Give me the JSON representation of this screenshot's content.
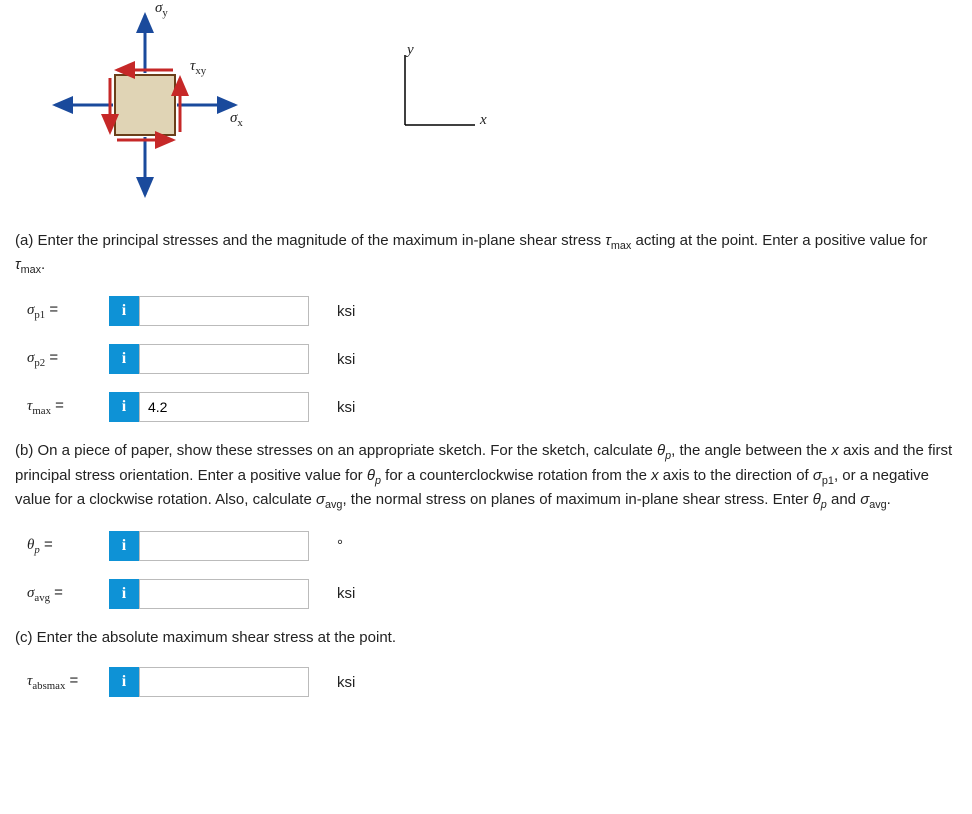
{
  "diagram": {
    "sigma_y_label": "σ",
    "sigma_y_sub": "y",
    "tau_xy_label": "τ",
    "tau_xy_sub": "xy",
    "sigma_x_label": "σ",
    "sigma_x_sub": "x",
    "axis_y": "y",
    "axis_x": "x"
  },
  "partA": {
    "prompt_before": "(a) Enter the principal stresses and the magnitude of the maximum in-plane shear stress ",
    "tau_sym": "τ",
    "tau_sub": "max",
    "prompt_mid": " acting at the point. Enter a positive value for ",
    "prompt_after": ".",
    "rows": [
      {
        "sym": "σ",
        "sub": "p1",
        "value": "",
        "unit": "ksi"
      },
      {
        "sym": "σ",
        "sub": "p2",
        "value": "",
        "unit": "ksi"
      },
      {
        "sym": "τ",
        "sub": "max",
        "value": "4.2",
        "unit": "ksi"
      }
    ]
  },
  "partB": {
    "prompt_1": "(b) On a piece of paper, show these stresses on an appropriate sketch. For the sketch, calculate ",
    "theta_sym": "θ",
    "theta_sub": "p",
    "prompt_2": ", the angle between the ",
    "x_var": "x",
    "prompt_3": " axis and the first principal stress orientation. Enter a positive value for ",
    "prompt_4": " for a counterclockwise rotation from the ",
    "prompt_5": " axis to the direction of ",
    "sig_sym": "σ",
    "sig_sub": "p1",
    "prompt_6": ", or a negative value for a clockwise rotation. Also, calculate ",
    "avg_sym": "σ",
    "avg_sub": "avg",
    "prompt_7": ", the normal stress on planes of maximum in-plane shear stress. Enter ",
    "prompt_8": " and ",
    "prompt_9": ".",
    "rows": [
      {
        "sym": "θ",
        "sub": "p",
        "value": "",
        "unit": "°"
      },
      {
        "sym": "σ",
        "sub": "avg",
        "value": "",
        "unit": "ksi"
      }
    ]
  },
  "partC": {
    "prompt": "(c) Enter the absolute maximum shear stress at the point.",
    "row": {
      "sym": "τ",
      "sub": "absmax",
      "value": "",
      "unit": "ksi"
    }
  },
  "info_icon": "i",
  "equals": " ="
}
